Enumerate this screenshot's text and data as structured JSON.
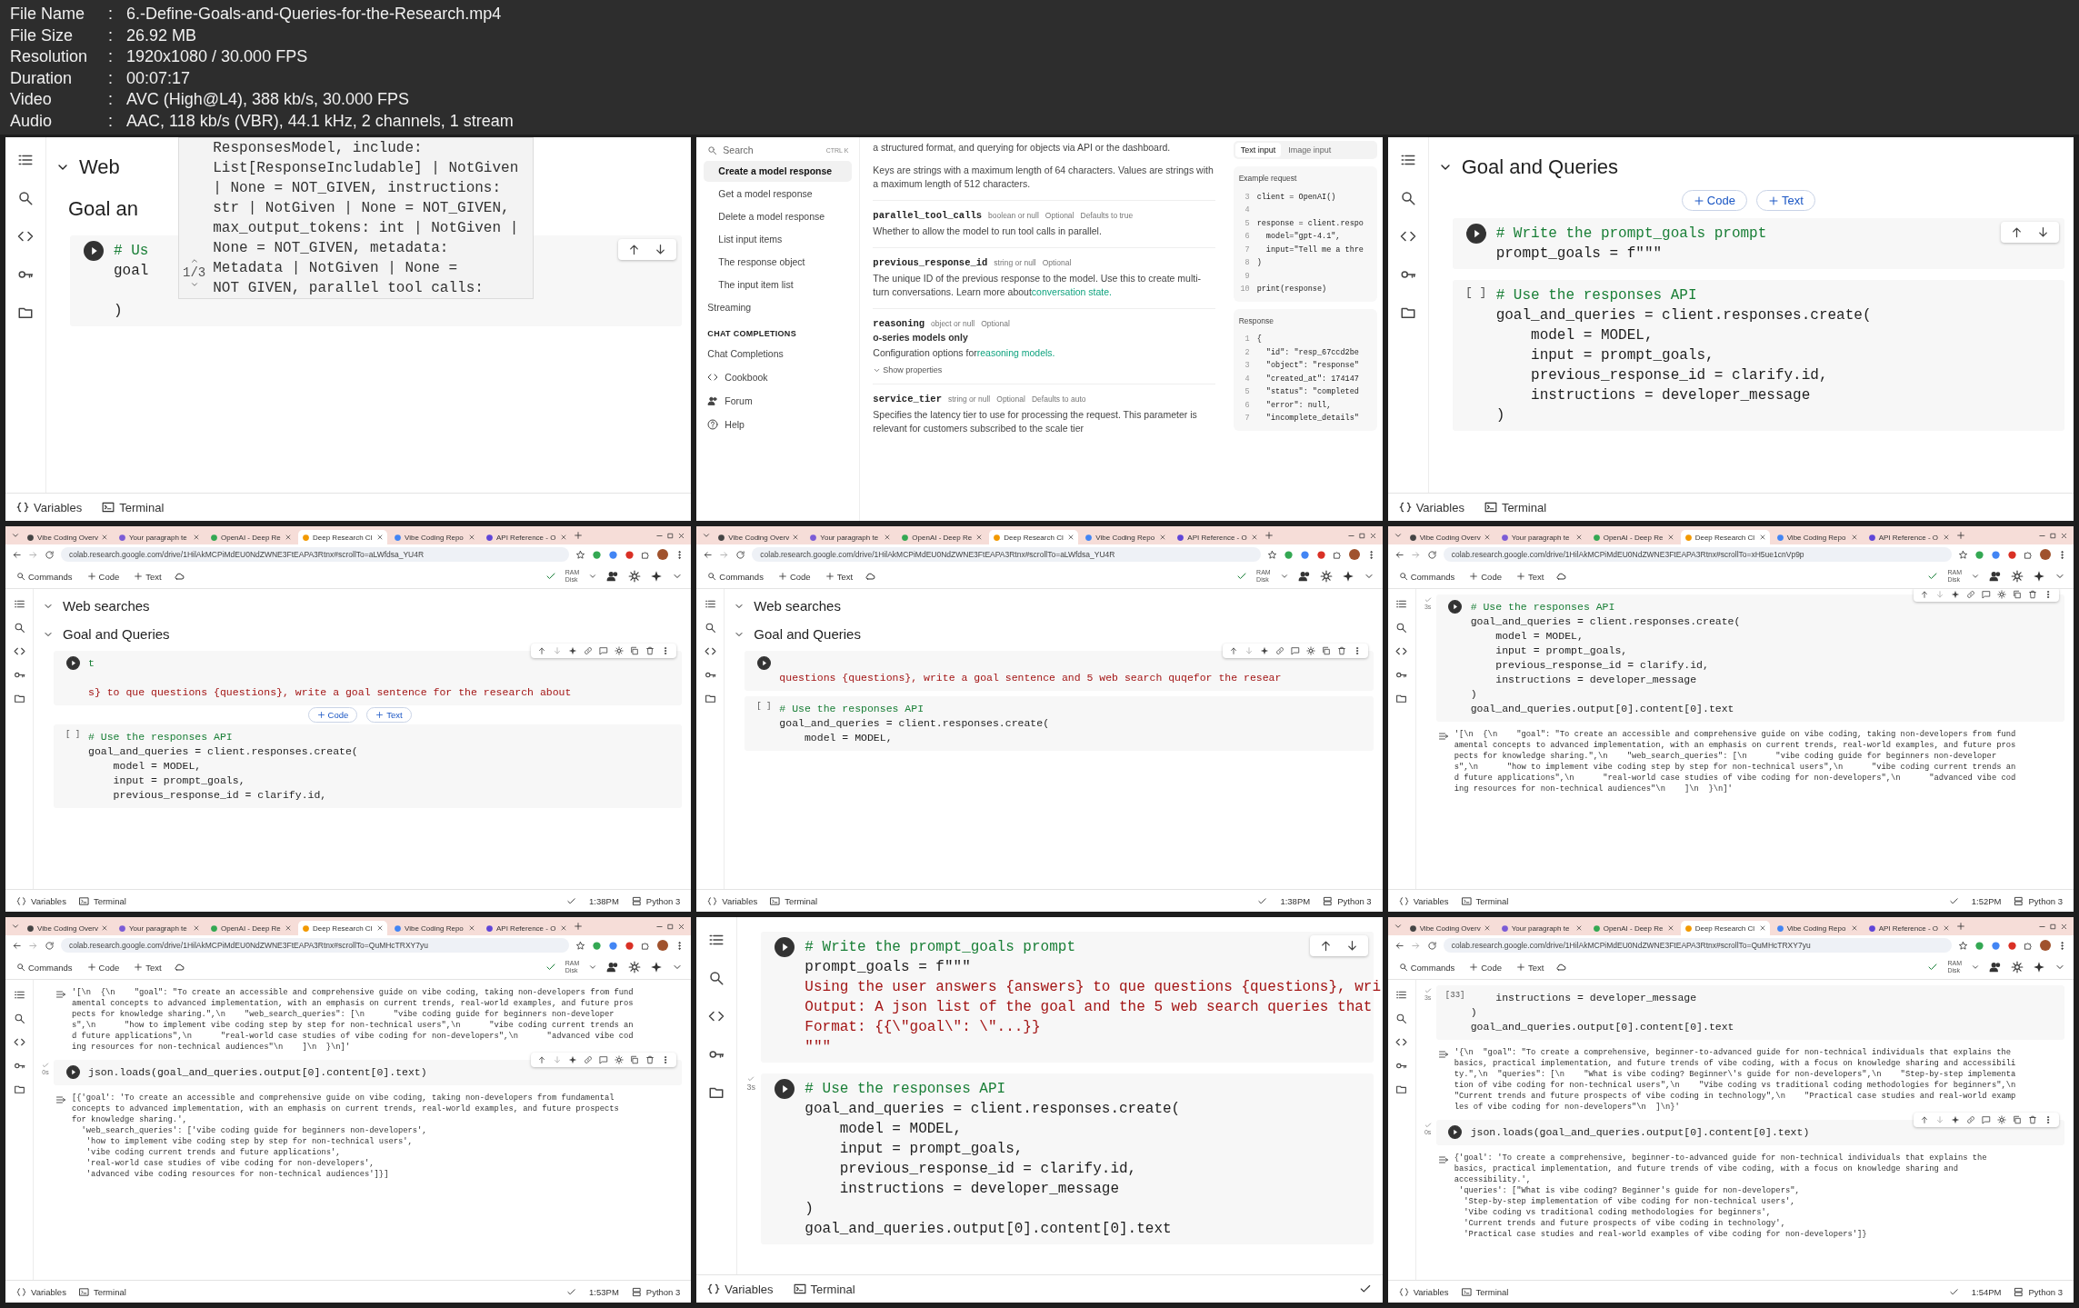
{
  "file_info": {
    "separator": ":",
    "rows": [
      {
        "label": "File Name",
        "value": "6.-Define-Goals-and-Queries-for-the-Research.mp4"
      },
      {
        "label": "File Size",
        "value": "26.92 MB"
      },
      {
        "label": "Resolution",
        "value": "1920x1080 / 30.000 FPS"
      },
      {
        "label": "Duration",
        "value": "00:07:17"
      },
      {
        "label": "Video",
        "value": "AVC (High@L4), 388 kb/s, 30.000 FPS"
      },
      {
        "label": "Audio",
        "value": "AAC, 118 kb/s (VBR), 44.1 kHz, 2 channels, 1 stream"
      }
    ]
  },
  "frames": [
    {
      "kind": "notebook",
      "blocks": [
        {
          "kind": "heading",
          "text": "Web",
          "expanded": true
        },
        {
          "kind": "title",
          "text": "Goal an"
        },
        {
          "kind": "code",
          "run": true,
          "done": false,
          "toolbar": true,
          "lines": [
            {
              "kind": "comment",
              "text": "# Us"
            },
            {
              "kind": "code",
              "text": "goal"
            },
            {
              "kind": "blank"
            },
            {
              "kind": "code",
              "text": ")"
            }
          ]
        }
      ],
      "popup": {
        "counter": "1/3",
        "lines": [
          "ResponsesModel, include:",
          "List[ResponseIncludable] | NotGiven",
          "| None = NOT_GIVEN, instructions:",
          "str | NotGiven | None = NOT_GIVEN,",
          "max_output_tokens: int | NotGiven |",
          "None = NOT_GIVEN, metadata:",
          "Metadata | NotGiven | None =",
          "NOT GIVEN, parallel tool calls:"
        ]
      },
      "footer": {
        "variables": "Variables",
        "terminal": "Terminal",
        "connected": false
      }
    },
    {
      "kind": "docs",
      "nav": {
        "search": "Search",
        "shortcut": "CTRL K",
        "items": [
          {
            "label": "Create a model response",
            "selected": true
          },
          {
            "label": "Get a model response",
            "selected": false
          },
          {
            "label": "Delete a model response",
            "selected": false
          },
          {
            "label": "List input items",
            "selected": false
          },
          {
            "label": "The response object",
            "selected": false
          },
          {
            "label": "The input item list",
            "selected": false
          },
          {
            "label": "Streaming",
            "selected": false
          }
        ],
        "section": "CHAT COMPLETIONS",
        "section_items": [
          "Chat Completions"
        ],
        "links": [
          "Cookbook",
          "Forum",
          "Help"
        ]
      },
      "content": {
        "intro": [
          "a structured format, and querying for objects via API or the dashboard.",
          "Keys are strings with a maximum length of 64 characters. Values are strings with a maximum length of 512 characters."
        ],
        "params": [
          {
            "name": "parallel_tool_calls",
            "type": "boolean or null",
            "optional": "Optional",
            "default": "Defaults to true",
            "desc": "Whether to allow the model to run tool calls in parallel."
          },
          {
            "name": "previous_response_id",
            "type": "string or null",
            "optional": "Optional",
            "desc": "The unique ID of the previous response to the model. Use this to create multi-turn conversations. Learn more about",
            "link": "conversation state."
          },
          {
            "name": "reasoning",
            "type": "object or null",
            "optional": "Optional",
            "note": "o-series models only",
            "desc": "Configuration options for",
            "link": "reasoning models.",
            "more": "Show properties"
          },
          {
            "name": "service_tier",
            "type": "string or null",
            "optional": "Optional",
            "default": "Defaults to auto",
            "desc": "Specifies the latency tier to use for processing the request. This parameter is relevant for customers subscribed to the scale tier"
          }
        ]
      },
      "code": {
        "tabs": [
          {
            "label": "Text input",
            "selected": true
          },
          {
            "label": "Image input",
            "selected": false
          }
        ],
        "request": {
          "title": "Example request",
          "lines": [
            {
              "n": "3",
              "text": "client = OpenAI()"
            },
            {
              "n": "4"
            },
            {
              "n": "5",
              "text": "response = client.respo"
            },
            {
              "n": "6",
              "text": "  model=\"gpt-4.1\","
            },
            {
              "n": "7",
              "text": "  input=\"Tell me a thre"
            },
            {
              "n": "8",
              "text": ")"
            },
            {
              "n": "9"
            },
            {
              "n": "10",
              "text": "print(response)"
            }
          ]
        },
        "response": {
          "title": "Response",
          "lines": [
            {
              "n": "1",
              "text": "{"
            },
            {
              "n": "2",
              "text": "  \"id\": \"resp_67ccd2be"
            },
            {
              "n": "3",
              "text": "  \"object\": \"response\""
            },
            {
              "n": "4",
              "text": "  \"created_at\": 174147"
            },
            {
              "n": "5",
              "text": "  \"status\": \"completed"
            },
            {
              "n": "6",
              "text": "  \"error\": null,"
            },
            {
              "n": "7",
              "text": "  \"incomplete_details\""
            }
          ]
        }
      }
    },
    {
      "kind": "notebook",
      "blocks": [
        {
          "kind": "heading",
          "text": "Goal and Queries",
          "expanded": true
        },
        {
          "kind": "insert",
          "buttons": [
            "Code",
            "Text"
          ]
        },
        {
          "kind": "code",
          "run": true,
          "done": false,
          "toolbar": true,
          "lines": [
            {
              "kind": "comment",
              "text": "# Write the prompt_goals prompt"
            },
            {
              "kind": "code",
              "text": "prompt_goals = f\"\"\""
            }
          ]
        },
        {
          "kind": "code",
          "run": false,
          "done": false,
          "count": "[ ]",
          "toolbar": false,
          "lines": [
            {
              "kind": "comment",
              "text": "# Use the responses API"
            },
            {
              "kind": "code",
              "text": "goal_and_queries = client.responses.create("
            },
            {
              "kind": "code",
              "text": "    model = MODEL,"
            },
            {
              "kind": "code",
              "text": "    input = prompt_goals,"
            },
            {
              "kind": "code",
              "text": "    previous_response_id = clarify.id,"
            },
            {
              "kind": "code",
              "text": "    instructions = developer_message"
            },
            {
              "kind": "code",
              "text": ")"
            }
          ]
        }
      ],
      "footer": {
        "variables": "Variables",
        "terminal": "Terminal",
        "connected": false
      }
    },
    {
      "kind": "notebook",
      "browser": {
        "tabs": [
          {
            "title": "Vibe Coding Overv",
            "selected": false
          },
          {
            "title": "Your paragraph te",
            "selected": false
          },
          {
            "title": "OpenAI - Deep Re",
            "selected": false
          },
          {
            "title": "Deep Research Cl",
            "selected": true
          },
          {
            "title": "Vibe Coding Repo",
            "selected": false
          },
          {
            "title": "API Reference - O",
            "selected": false
          }
        ],
        "url": "colab.research.google.com/drive/1HilAkMCPiMdEU0NdZWNE3FtEAPA3Rtnx#scrollTo=aLWfdsa_YU4R"
      },
      "toolbar": {
        "commands": "Commands",
        "code": "Code",
        "text": "Text",
        "ram": "RAM",
        "disk": "Disk"
      },
      "blocks": [
        {
          "kind": "heading",
          "text": "Web searches",
          "expanded": true
        },
        {
          "kind": "heading",
          "text": "Goal and Queries",
          "expanded": true
        },
        {
          "kind": "code",
          "run": true,
          "done": false,
          "toolbar": true,
          "lines": [
            {
              "kind": "comment",
              "text": "t"
            },
            {
              "kind": "blank"
            },
            {
              "kind": "string",
              "text": "s} to que questions {questions}, write a goal sentence for the research about"
            }
          ]
        },
        {
          "kind": "insert",
          "buttons": [
            "Code",
            "Text"
          ]
        },
        {
          "kind": "code",
          "run": false,
          "done": false,
          "count": "[ ]",
          "toolbar": false,
          "lines": [
            {
              "kind": "comment",
              "text": "# Use the responses API"
            },
            {
              "kind": "code",
              "text": "goal_and_queries = client.responses.create("
            },
            {
              "kind": "code",
              "text": "    model = MODEL,"
            },
            {
              "kind": "code",
              "text": "    input = prompt_goals,"
            },
            {
              "kind": "code",
              "text": "    previous_response_id = clarify.id,"
            }
          ]
        }
      ],
      "footer": {
        "variables": "Variables",
        "terminal": "Terminal",
        "connected": true,
        "time": "1:38PM",
        "runtime": "Python 3"
      }
    },
    {
      "kind": "notebook",
      "browser": {
        "tabs": [
          {
            "title": "Vibe Coding Overv",
            "selected": false
          },
          {
            "title": "Your paragraph te",
            "selected": false
          },
          {
            "title": "OpenAI - Deep Re",
            "selected": false
          },
          {
            "title": "Deep Research Cl",
            "selected": true
          },
          {
            "title": "Vibe Coding Repo",
            "selected": false
          },
          {
            "title": "API Reference - O",
            "selected": false
          }
        ],
        "url": "colab.research.google.com/drive/1HilAkMCPiMdEU0NdZWNE3FtEAPA3Rtnx#scrollTo=aLWfdsa_YU4R"
      },
      "toolbar": {
        "commands": "Commands",
        "code": "Code",
        "text": "Text",
        "ram": "RAM",
        "disk": "Disk"
      },
      "blocks": [
        {
          "kind": "heading",
          "text": "Web searches",
          "expanded": true
        },
        {
          "kind": "heading",
          "text": "Goal and Queries",
          "expanded": true
        },
        {
          "kind": "code",
          "run": true,
          "done": false,
          "toolbar": true,
          "lines": [
            {
              "kind": "blank"
            },
            {
              "kind": "string",
              "text": "questions {questions}, write a goal sentence and 5 web search quqefor the resear"
            }
          ]
        },
        {
          "kind": "code",
          "run": false,
          "done": false,
          "count": "[ ]",
          "toolbar": false,
          "lines": [
            {
              "kind": "comment",
              "text": "# Use the responses API"
            },
            {
              "kind": "code",
              "text": "goal_and_queries = client.responses.create("
            },
            {
              "kind": "code",
              "text": "    model = MODEL,"
            }
          ]
        }
      ],
      "footer": {
        "variables": "Variables",
        "terminal": "Terminal",
        "connected": true,
        "time": "1:38PM",
        "runtime": "Python 3"
      }
    },
    {
      "kind": "notebook",
      "browser": {
        "tabs": [
          {
            "title": "Vibe Coding Overv",
            "selected": false
          },
          {
            "title": "Your paragraph te",
            "selected": false
          },
          {
            "title": "OpenAI - Deep Re",
            "selected": false
          },
          {
            "title": "Deep Research Cl",
            "selected": true
          },
          {
            "title": "Vibe Coding Repo",
            "selected": false
          },
          {
            "title": "API Reference - O",
            "selected": false
          }
        ],
        "url": "colab.research.google.com/drive/1HilAkMCPiMdEU0NdZWNE3FtEAPA3Rtnx#scrollTo=xH5ue1cnVp9p"
      },
      "toolbar": {
        "commands": "Commands",
        "code": "Code",
        "text": "Text",
        "ram": "RAM",
        "disk": "Disk"
      },
      "blocks": [
        {
          "kind": "code",
          "run": true,
          "done": true,
          "time": "3s",
          "toolbar": true,
          "lines": [
            {
              "kind": "comment",
              "text": "# Use the responses API"
            },
            {
              "kind": "code",
              "text": "goal_and_queries = client.responses.create("
            },
            {
              "kind": "code",
              "text": "    model = MODEL,"
            },
            {
              "kind": "code",
              "text": "    input = prompt_goals,"
            },
            {
              "kind": "code",
              "text": "    previous_response_id = clarify.id,"
            },
            {
              "kind": "code",
              "text": "    instructions = developer_message"
            },
            {
              "kind": "code",
              "text": ")"
            },
            {
              "kind": "code",
              "text": "goal_and_queries.output[0].content[0].text"
            }
          ]
        },
        {
          "kind": "output",
          "lines": [
            "'[\\n  {\\n    \"goal\": \"To create an accessible and comprehensive guide on vibe coding, taking non-developers from fund",
            "amental concepts to advanced implementation, with an emphasis on current trends, real-world examples, and future pros",
            "pects for knowledge sharing.\",\\n    \"web_search_queries\": [\\n      \"vibe coding guide for beginners non-developer",
            "s\",\\n      \"how to implement vibe coding step by step for non-technical users\",\\n      \"vibe coding current trends an",
            "d future applications\",\\n      \"real-world case studies of vibe coding for non-developers\",\\n      \"advanced vibe cod",
            "ing resources for non-technical audiences\"\\n    ]\\n  }\\n]'"
          ]
        }
      ],
      "footer": {
        "variables": "Variables",
        "terminal": "Terminal",
        "connected": true,
        "time": "1:52PM",
        "runtime": "Python 3"
      }
    },
    {
      "kind": "notebook",
      "browser": {
        "tabs": [
          {
            "title": "Vibe Coding Overv",
            "selected": false
          },
          {
            "title": "Your paragraph te",
            "selected": false
          },
          {
            "title": "OpenAI - Deep Re",
            "selected": false
          },
          {
            "title": "Deep Research Cl",
            "selected": true
          },
          {
            "title": "Vibe Coding Repo",
            "selected": false
          },
          {
            "title": "API Reference - O",
            "selected": false
          }
        ],
        "url": "colab.research.google.com/drive/1HilAkMCPiMdEU0NdZWNE3FtEAPA3Rtnx#scrollTo=QuMHcTRXY7yu"
      },
      "toolbar": {
        "commands": "Commands",
        "code": "Code",
        "text": "Text",
        "ram": "RAM",
        "disk": "Disk"
      },
      "blocks": [
        {
          "kind": "output",
          "lines": [
            "'[\\n  {\\n    \"goal\": \"To create an accessible and comprehensive guide on vibe coding, taking non-developers from fund",
            "amental concepts to advanced implementation, with an emphasis on current trends, real-world examples, and future pros",
            "pects for knowledge sharing.\",\\n    \"web_search_queries\": [\\n      \"vibe coding guide for beginners non-developer",
            "s\",\\n      \"how to implement vibe coding step by step for non-technical users\",\\n      \"vibe coding current trends an",
            "d future applications\",\\n      \"real-world case studies of vibe coding for non-developers\",\\n      \"advanced vibe cod",
            "ing resources for non-technical audiences\"\\n    ]\\n  }\\n]'"
          ]
        },
        {
          "kind": "code",
          "run": true,
          "done": true,
          "time": "0s",
          "toolbar": true,
          "lines": [
            {
              "kind": "code",
              "text": "json.loads(goal_and_queries.output[0].content[0].text)"
            }
          ]
        },
        {
          "kind": "output",
          "lines": [
            "[{'goal': 'To create an accessible and comprehensive guide on vibe coding, taking non-developers from fundamental",
            "concepts to advanced implementation, with an emphasis on current trends, real-world examples, and future prospects",
            "for knowledge sharing.',",
            "  'web_search_queries': ['vibe coding guide for beginners non-developers',",
            "   'how to implement vibe coding step by step for non-technical users',",
            "   'vibe coding current trends and future applications',",
            "   'real-world case studies of vibe coding for non-developers',",
            "   'advanced vibe coding resources for non-technical audiences']}]"
          ]
        }
      ],
      "footer": {
        "variables": "Variables",
        "terminal": "Terminal",
        "connected": true,
        "time": "1:53PM",
        "runtime": "Python 3"
      }
    },
    {
      "kind": "notebook",
      "blocks": [
        {
          "kind": "code",
          "run": true,
          "done": false,
          "toolbar": true,
          "lines": [
            {
              "kind": "comment",
              "text": "# Write the prompt_goals prompt"
            },
            {
              "kind": "code",
              "text": "prompt_goals = f\"\"\""
            },
            {
              "kind": "string",
              "text": "Using the user answers {answers} to que questions {questions}, wri"
            },
            {
              "kind": "string",
              "text": "Output: A json list of the goal and the 5 web search queries that"
            },
            {
              "kind": "string",
              "text": "Format: {{\\\"goal\\\": \\\"...}}"
            },
            {
              "kind": "string",
              "text": "\"\"\""
            }
          ]
        },
        {
          "kind": "code",
          "run": true,
          "done": true,
          "time": "3s",
          "toolbar": false,
          "lines": [
            {
              "kind": "comment",
              "text": "# Use the responses API"
            },
            {
              "kind": "code",
              "text": "goal_and_queries = client.responses.create("
            },
            {
              "kind": "code",
              "text": "    model = MODEL,"
            },
            {
              "kind": "code",
              "text": "    input = prompt_goals,"
            },
            {
              "kind": "code",
              "text": "    previous_response_id = clarify.id,"
            },
            {
              "kind": "code",
              "text": "    instructions = developer_message"
            },
            {
              "kind": "code",
              "text": ")"
            },
            {
              "kind": "code",
              "text": "goal_and_queries.output[0].content[0].text"
            }
          ]
        }
      ],
      "footer": {
        "variables": "Variables",
        "terminal": "Terminal",
        "connected": true
      }
    },
    {
      "kind": "notebook",
      "browser": {
        "tabs": [
          {
            "title": "Vibe Coding Overv",
            "selected": false
          },
          {
            "title": "Your paragraph te",
            "selected": false
          },
          {
            "title": "OpenAI - Deep Re",
            "selected": false
          },
          {
            "title": "Deep Research Cl",
            "selected": true
          },
          {
            "title": "Vibe Coding Repo",
            "selected": false
          },
          {
            "title": "API Reference - O",
            "selected": false
          }
        ],
        "url": "colab.research.google.com/drive/1HilAkMCPiMdEU0NdZWNE3FtEAPA3Rtnx#scrollTo=QuMHcTRXY7yu"
      },
      "toolbar": {
        "commands": "Commands",
        "code": "Code",
        "text": "Text",
        "ram": "RAM",
        "disk": "Disk"
      },
      "blocks": [
        {
          "kind": "code",
          "run": false,
          "done": true,
          "count": "[33]",
          "time": "3s",
          "toolbar": false,
          "lines": [
            {
              "kind": "code",
              "text": "    instructions = developer_message"
            },
            {
              "kind": "code",
              "text": ")"
            },
            {
              "kind": "code",
              "text": "goal_and_queries.output[0].content[0].text"
            }
          ]
        },
        {
          "kind": "output",
          "lines": [
            "'{\\n  \"goal\": \"To create a comprehensive, beginner-to-advanced guide for non-technical individuals that explains the",
            "basics, practical implementation, and future trends of vibe coding, with a focus on knowledge sharing and accessibili",
            "ty.\",\\n  \"queries\": [\\n    \"What is vibe coding? Beginner\\'s guide for non-developers\",\\n    \"Step-by-step implementa",
            "tion of vibe coding for non-technical users\",\\n    \"Vibe coding vs traditional coding methodologies for beginners\",\\n",
            "\"Current trends and future prospects of vibe coding in technology\",\\n    \"Practical case studies and real-world examp",
            "les of vibe coding for non-developers\"\\n  ]\\n}'"
          ]
        },
        {
          "kind": "code",
          "run": true,
          "done": true,
          "time": "0s",
          "toolbar": true,
          "lines": [
            {
              "kind": "code",
              "text": "json.loads(goal_and_queries.output[0].content[0].text)"
            }
          ]
        },
        {
          "kind": "output",
          "lines": [
            "{'goal': 'To create a comprehensive, beginner-to-advanced guide for non-technical individuals that explains the",
            "basics, practical implementation, and future trends of vibe coding, with a focus on knowledge sharing and",
            "accessibility.',",
            " 'queries': [\"What is vibe coding? Beginner's guide for non-developers\",",
            "  'Step-by-step implementation of vibe coding for non-technical users',",
            "  'Vibe coding vs traditional coding methodologies for beginners',",
            "  'Current trends and future prospects of vibe coding in technology',",
            "  'Practical case studies and real-world examples of vibe coding for non-developers']}"
          ]
        }
      ],
      "footer": {
        "variables": "Variables",
        "terminal": "Terminal",
        "connected": true,
        "time": "1:54PM",
        "runtime": "Python 3"
      }
    }
  ]
}
